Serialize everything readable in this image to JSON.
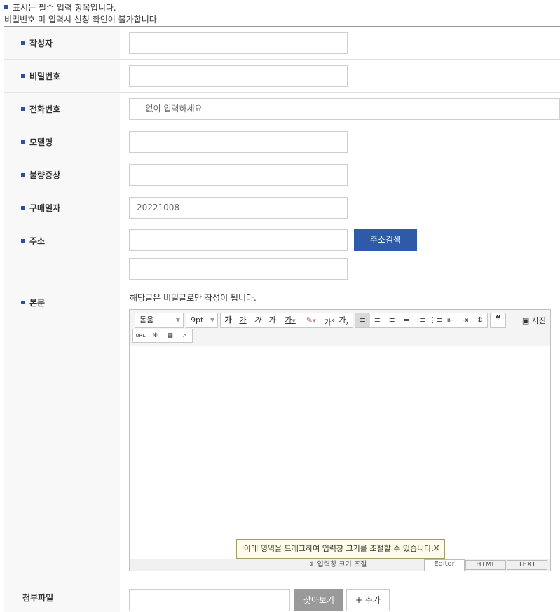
{
  "notice": {
    "line1": "표시는 필수 입력 항목입니다.",
    "line2": "비밀번호 미 입력시 신청 확인이 불가합니다."
  },
  "form": {
    "author_label": "작성자",
    "password_label": "비밀번호",
    "phone_label": "전화번호",
    "phone_placeholder": "- -없이 입력하세요",
    "model_label": "모델명",
    "symptom_label": "불량증상",
    "purchase_label": "구매일자",
    "purchase_value": "20221008",
    "address_label": "주소",
    "address_search_button": "주소검색",
    "body_label": "본문",
    "secret_note": "해당글은 비밀글로만 작성이 됩니다.",
    "attach_label": "첨부파일",
    "browse_button": "찾아보기",
    "add_button": "+ 추가"
  },
  "editor": {
    "font_select": "돋움",
    "size_select": "9pt",
    "photo_button": "사진",
    "tooltip": "아래 영역을 드래그하여 입력창 크기를 조절할 수 있습니다.",
    "resize_label": "⇕ 입력창 크기 조절",
    "modes": [
      "Editor",
      "HTML",
      "TEXT"
    ],
    "format_buttons": [
      "가",
      "가",
      "가",
      "가",
      "가",
      "가",
      "가",
      "가"
    ],
    "align_icons": [
      "align-left-icon",
      "align-center-icon",
      "align-right-icon",
      "align-justify-icon",
      "ordered-list-icon",
      "unordered-list-icon",
      "outdent-icon",
      "indent-icon",
      "line-height-icon"
    ],
    "row2_icons": [
      "url-icon",
      "special-char-icon",
      "table-icon",
      "find-icon"
    ]
  },
  "colors": {
    "accent": "#2e5aa9",
    "bullet": "#2c4f9e",
    "label_bg": "#f8f8f8"
  }
}
